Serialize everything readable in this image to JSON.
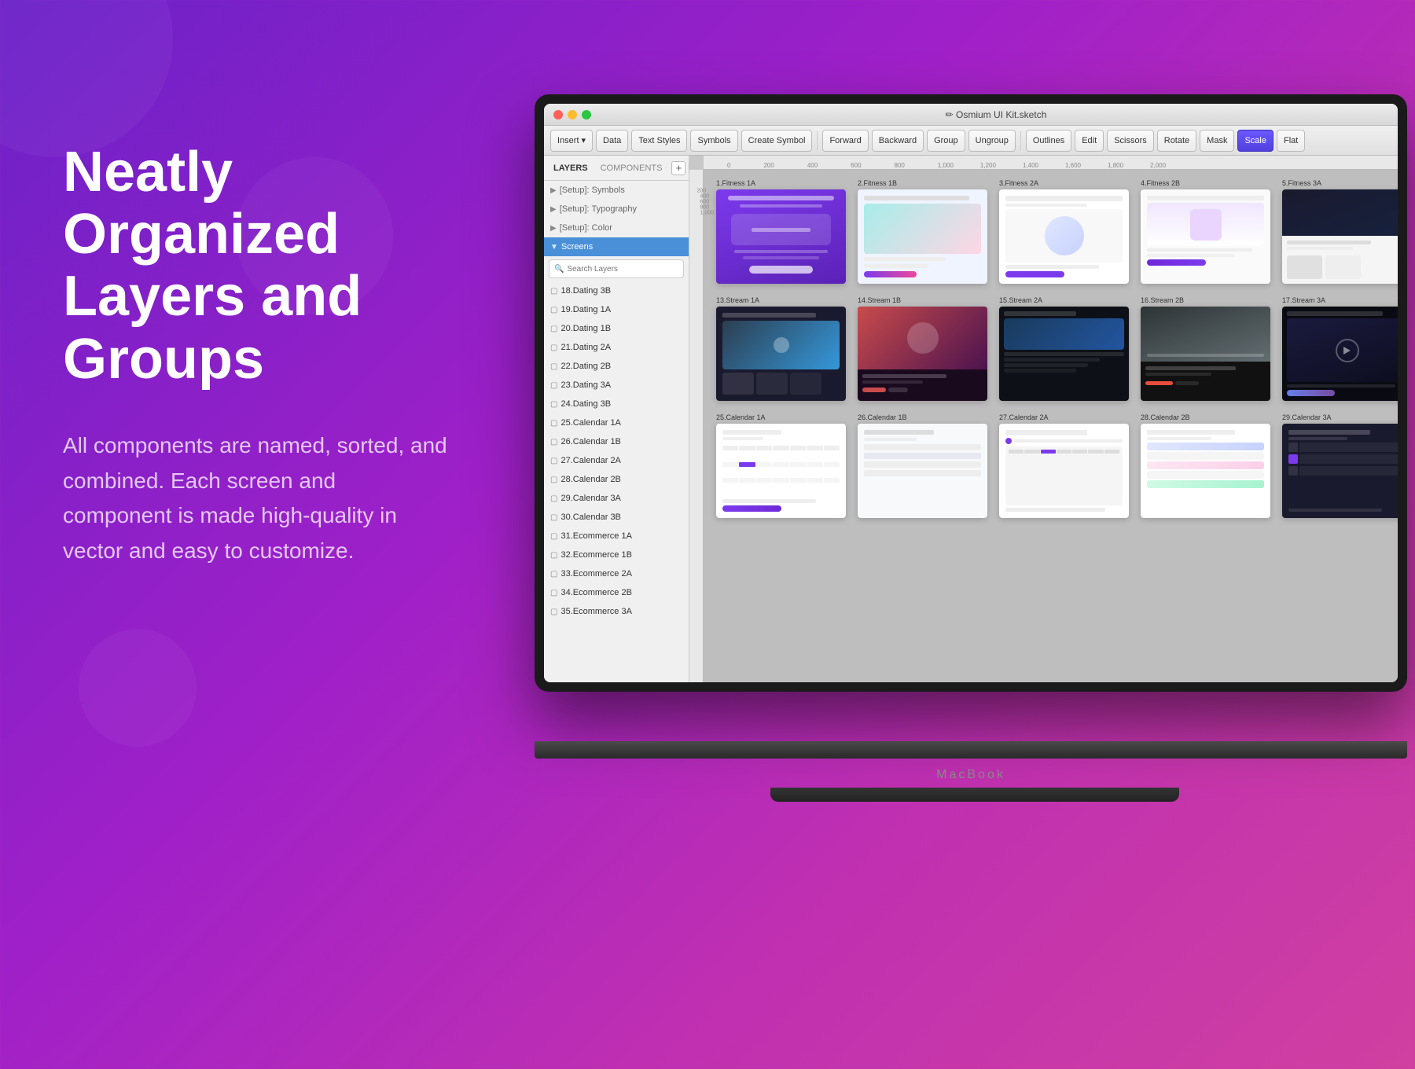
{
  "background": {
    "gradient_start": "#6B21C8",
    "gradient_end": "#D040A0"
  },
  "heading": {
    "line1": "Neatly",
    "line2": "Organized",
    "line3": "Layers and",
    "line4": "Groups"
  },
  "subtext": "All components are named, sorted, and combined. Each screen and component is made high-quality in vector and easy to customize.",
  "macbook": {
    "label": "MacBook"
  },
  "sketch": {
    "title": "✏ Osmium UI Kit.sketch",
    "toolbar": {
      "buttons": [
        "Insert",
        "Data",
        "Text Styles",
        "Symbols",
        "Create Symbol",
        "Forward",
        "Backward",
        "Group",
        "Ungroup",
        "Outlines",
        "Edit",
        "Scissors",
        "Rotate",
        "Mask",
        "Scale",
        "Flat"
      ]
    },
    "sidebar": {
      "tab_layers": "LAYERS",
      "tab_components": "COMPONENTS",
      "items": [
        {
          "label": "[Setup]: Symbols",
          "type": "setup"
        },
        {
          "label": "[Setup]: Typography",
          "type": "setup"
        },
        {
          "label": "[Setup]: Color",
          "type": "setup"
        },
        {
          "label": "Screens",
          "type": "selected"
        },
        {
          "label": "18.Dating 3B"
        },
        {
          "label": "19.Dating 1A"
        },
        {
          "label": "20.Dating 1B"
        },
        {
          "label": "21.Dating 2A"
        },
        {
          "label": "22.Dating 2B"
        },
        {
          "label": "23.Dating 3A"
        },
        {
          "label": "24.Dating 3B"
        },
        {
          "label": "25.Calendar 1A"
        },
        {
          "label": "26.Calendar 1B"
        },
        {
          "label": "27.Calendar 2A"
        },
        {
          "label": "28.Calendar 2B"
        },
        {
          "label": "29.Calendar 3A"
        },
        {
          "label": "30.Calendar 3B"
        },
        {
          "label": "31.Ecommerce 1A"
        },
        {
          "label": "32.Ecommerce 1B"
        },
        {
          "label": "33.Ecommerce 2A"
        },
        {
          "label": "34.Ecommerce 2B"
        },
        {
          "label": "35.Ecommerce 3A"
        }
      ]
    },
    "canvas": {
      "row1_label": "",
      "screens_row1": [
        {
          "id": "1.Fitness 1A",
          "label": "1.Fitness 1A"
        },
        {
          "id": "2.Fitness 1B",
          "label": "2.Fitness 1B"
        },
        {
          "id": "3.Fitness 2A",
          "label": "3.Fitness 2A"
        },
        {
          "id": "4.Fitness 2B",
          "label": "4.Fitness 2B"
        },
        {
          "id": "5.Fitness 3A",
          "label": "5.Fitness 3A"
        }
      ],
      "screens_row2": [
        {
          "id": "13.Stream 1A",
          "label": "13.Stream 1A"
        },
        {
          "id": "14.Stream 1B",
          "label": "14.Stream 1B"
        },
        {
          "id": "15.Stream 2A",
          "label": "15.Stream 2A"
        },
        {
          "id": "16.Stream 2B",
          "label": "16.Stream 2B"
        },
        {
          "id": "17.Stream 3A",
          "label": "17.Stream 3A"
        }
      ],
      "screens_row3": [
        {
          "id": "25.Calendar 1A",
          "label": "25.Calendar 1A"
        },
        {
          "id": "26.Calendar 1B",
          "label": "26.Calendar 1B"
        },
        {
          "id": "27.Calendar 2A",
          "label": "27.Calendar 2A"
        },
        {
          "id": "28.Calendar 2B",
          "label": "28.Calendar 2B"
        },
        {
          "id": "29.Calendar 3A",
          "label": "29.Calendar 3A"
        }
      ]
    }
  }
}
